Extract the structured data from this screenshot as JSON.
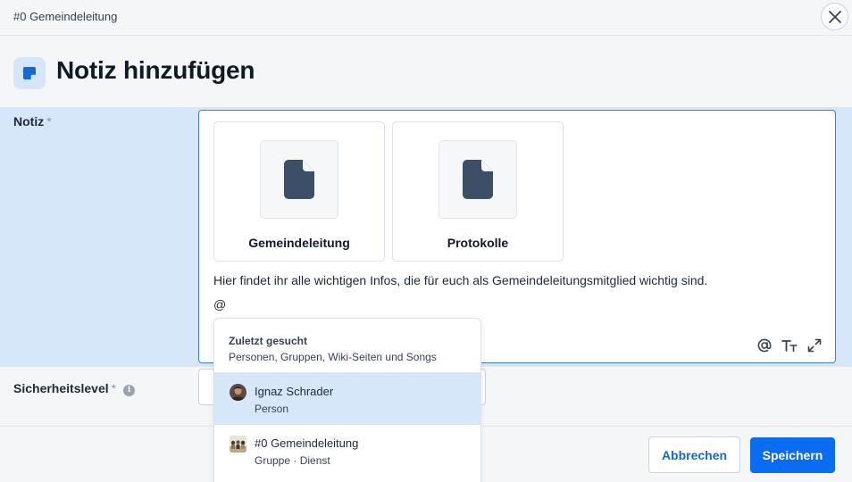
{
  "header": {
    "breadcrumb": "#0 Gemeindeleitung",
    "close_icon": "close-icon"
  },
  "page": {
    "title": "Notiz hinzufügen",
    "title_icon": "note-icon"
  },
  "form": {
    "notiz": {
      "label": "Notiz",
      "required_mark": "*",
      "cards": [
        {
          "title": "Gemeindeleitung",
          "icon": "file-icon"
        },
        {
          "title": "Protokolle",
          "icon": "file-icon"
        }
      ],
      "text": "Hier findet ihr alle wichtigen Infos, die für euch als Gemeindeleitungsmitglied wichtig sind.",
      "mention_input": "@",
      "toolbar": [
        "mention-icon",
        "text-format-icon",
        "expand-icon"
      ]
    },
    "sicherheitslevel": {
      "label": "Sicherheitslevel",
      "required_mark": "*",
      "info_icon": "i"
    }
  },
  "mention_dropdown": {
    "heading": "Zuletzt gesucht",
    "subheading": "Personen, Gruppen, Wiki-Seiten und Songs",
    "items": [
      {
        "name": "Ignaz Schrader",
        "type": "Person",
        "active": true
      },
      {
        "name": "#0 Gemeindeleitung",
        "type": "Gruppe · Dienst",
        "active": false
      }
    ]
  },
  "footer": {
    "cancel_label": "Abbrechen",
    "save_label": "Speichern"
  },
  "colors": {
    "accent": "#0a6cf0",
    "row_highlight": "#d7e7fa",
    "link": "#1769d1"
  }
}
